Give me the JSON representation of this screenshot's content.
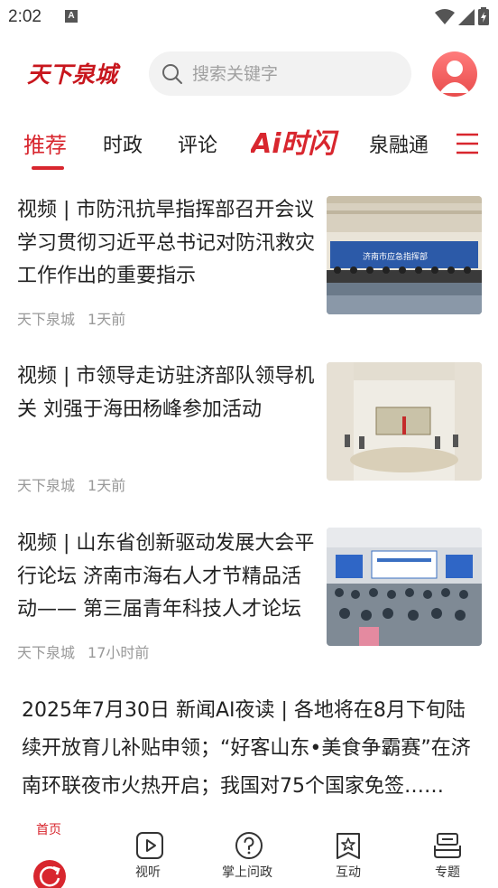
{
  "status_bar": {
    "time": "2:02",
    "notification_icon": "A"
  },
  "header": {
    "logo_text": "天下泉城",
    "search_placeholder": "搜索关键字"
  },
  "tabs": [
    {
      "label": "推荐",
      "active": true
    },
    {
      "label": "时政",
      "active": false
    },
    {
      "label": "评论",
      "active": false
    },
    {
      "label": "Ai时闪",
      "active": false
    },
    {
      "label": "泉融通",
      "active": false
    }
  ],
  "articles": [
    {
      "title": "视频 | 市防汛抗旱指挥部召开会议学习贯彻习近平总书记对防汛救灾工作作出的重要指示",
      "source": "天下泉城",
      "time": "1天前",
      "image_caption": "济南市应急指挥部"
    },
    {
      "title": "视频 | 市领导走访驻济部队领导机关 刘强于海田杨峰参加活动",
      "source": "天下泉城",
      "time": "1天前"
    },
    {
      "title": "视频 | 山东省创新驱动发展大会平行论坛 济南市海右人才节精品活动—— 第三届青年科技人才论坛",
      "source": "天下泉城",
      "time": "17小时前"
    }
  ],
  "night_read": {
    "text": "2025年7月30日 新闻AI夜读 | 各地将在8月下旬陆续开放育儿补贴申领；“好客山东•美食争霸赛”在济南环联夜市火热开启；我国对75个国家免签……"
  },
  "bottom_nav": [
    {
      "label": "首页",
      "icon": "home-refresh-icon",
      "active": true
    },
    {
      "label": "视听",
      "icon": "play-icon",
      "active": false
    },
    {
      "label": "掌上问政",
      "icon": "question-icon",
      "active": false
    },
    {
      "label": "互动",
      "icon": "star-bookmark-icon",
      "active": false
    },
    {
      "label": "专题",
      "icon": "stack-icon",
      "active": false
    }
  ],
  "colors": {
    "accent": "#d8262e",
    "muted": "#999999"
  }
}
